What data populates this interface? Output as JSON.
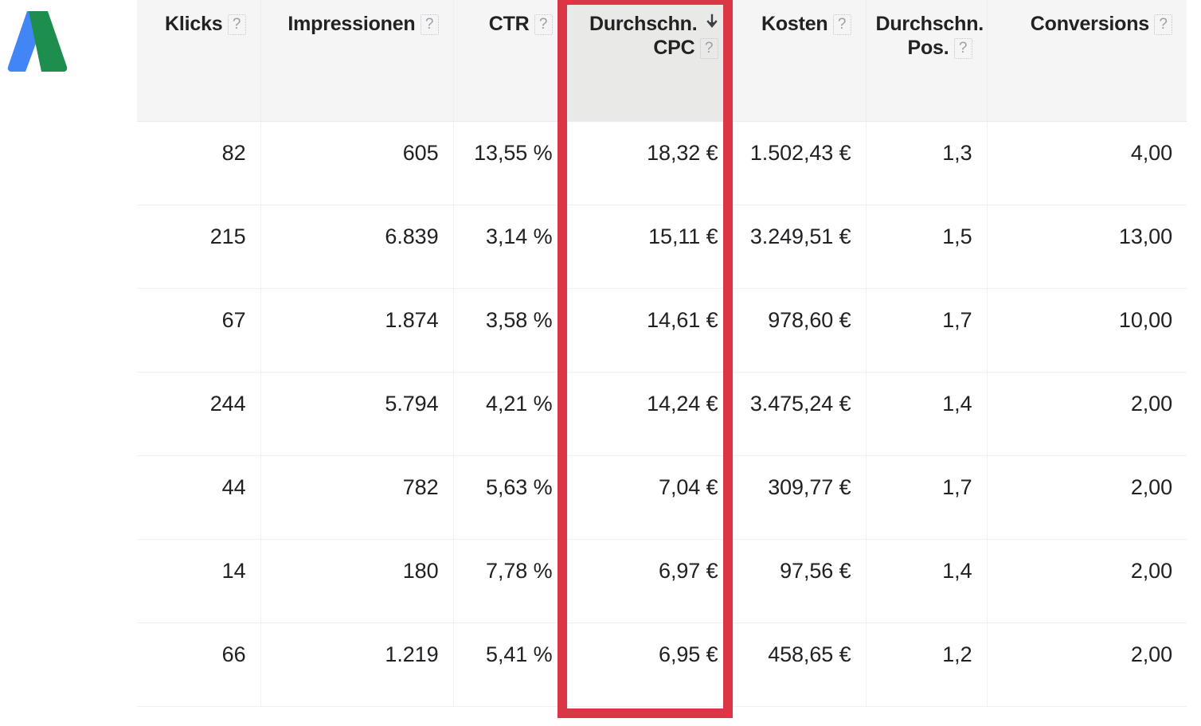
{
  "logo": {
    "name": "google-adwords-logo",
    "colors": {
      "blue": "#4285F4",
      "green": "#1E8E4E"
    }
  },
  "accent": {
    "highlight_box_color": "#dc3545",
    "sorted_header_bg": "#e9e9e7",
    "header_bg": "#f5f5f5"
  },
  "table": {
    "help_icon_glyph": "?",
    "sort_direction": "descending",
    "sorted_column_index": 3,
    "columns": [
      {
        "label": "Klicks",
        "help": "?",
        "sorted": false,
        "lines": [
          "Klicks"
        ]
      },
      {
        "label": "Impressionen",
        "help": "?",
        "sorted": false,
        "lines": [
          "Impressionen"
        ]
      },
      {
        "label": "CTR",
        "help": "?",
        "sorted": false,
        "lines": [
          "CTR"
        ]
      },
      {
        "label": "Durchschn. CPC",
        "help": "?",
        "sorted": true,
        "lines": [
          "Durchschn.",
          "CPC"
        ]
      },
      {
        "label": "Kosten",
        "help": "?",
        "sorted": false,
        "lines": [
          "Kosten"
        ]
      },
      {
        "label": "Durchschn. Pos.",
        "help": "?",
        "sorted": false,
        "lines": [
          "Durchschn.",
          "Pos."
        ]
      },
      {
        "label": "Conversions",
        "help": "?",
        "sorted": false,
        "lines": [
          "Conversions"
        ]
      }
    ],
    "rows": [
      {
        "klicks": "82",
        "impressionen": "605",
        "ctr": "13,55 %",
        "cpc": "18,32 €",
        "kosten": "1.502,43 €",
        "pos": "1,3",
        "conversions": "4,00"
      },
      {
        "klicks": "215",
        "impressionen": "6.839",
        "ctr": "3,14 %",
        "cpc": "15,11 €",
        "kosten": "3.249,51 €",
        "pos": "1,5",
        "conversions": "13,00"
      },
      {
        "klicks": "67",
        "impressionen": "1.874",
        "ctr": "3,58 %",
        "cpc": "14,61 €",
        "kosten": "978,60 €",
        "pos": "1,7",
        "conversions": "10,00"
      },
      {
        "klicks": "244",
        "impressionen": "5.794",
        "ctr": "4,21 %",
        "cpc": "14,24 €",
        "kosten": "3.475,24 €",
        "pos": "1,4",
        "conversions": "2,00"
      },
      {
        "klicks": "44",
        "impressionen": "782",
        "ctr": "5,63 %",
        "cpc": "7,04 €",
        "kosten": "309,77 €",
        "pos": "1,7",
        "conversions": "2,00"
      },
      {
        "klicks": "14",
        "impressionen": "180",
        "ctr": "7,78 %",
        "cpc": "6,97 €",
        "kosten": "97,56 €",
        "pos": "1,4",
        "conversions": "2,00"
      },
      {
        "klicks": "66",
        "impressionen": "1.219",
        "ctr": "5,41 %",
        "cpc": "6,95 €",
        "kosten": "458,65 €",
        "pos": "1,2",
        "conversions": "2,00"
      }
    ]
  }
}
